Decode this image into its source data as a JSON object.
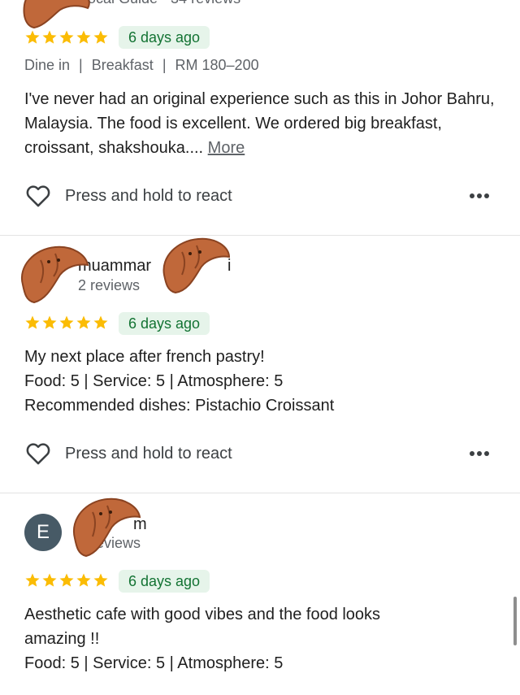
{
  "reviews": [
    {
      "sub_partial": "ocal Guide · 34 reviews",
      "rating": 5,
      "time": "6 days ago",
      "tags": {
        "t1": "Dine in",
        "sep1": "|",
        "t2": "Breakfast",
        "sep2": "|",
        "t3": "RM 180–200"
      },
      "text": "I've never had an original experience such as this in Johor Bahru, Malaysia. The food is excellent. We ordered big breakfast, croissant, shakshouka.... ",
      "more": "More",
      "react": "Press and hold to react"
    },
    {
      "name_left": "muammar",
      "name_right": "i",
      "sub": "2 reviews",
      "rating": 5,
      "time": "6 days ago",
      "line1": "My next place after french pastry!",
      "food_label": "Food:",
      "food_val": " 5 | ",
      "service_label": "Service:",
      "service_val": " 5 | ",
      "atmos_label": "Atmosphere:",
      "atmos_val": " 5",
      "dishes_label": "Recommended dishes:",
      "dishes_val": " Pistachio Croissant",
      "react": "Press and hold to react"
    },
    {
      "avatar_letter": "E",
      "name_right": "m",
      "sub_partial": "eviews",
      "rating": 5,
      "time": "6 days ago",
      "line1": "Aesthetic cafe with good vibes and the food looks amazing !!",
      "food_label": "Food:",
      "food_val": " 5 | ",
      "service_label": "Service:",
      "service_val": " 5 | ",
      "atmos_label": "Atmosphere:",
      "atmos_val": " 5"
    }
  ],
  "colors": {
    "star": "#fbbc04",
    "chip_bg": "#e6f4ea",
    "chip_text": "#137333",
    "avatar": "#475a66",
    "croissant": "#c0683a"
  },
  "icons": {
    "react": "heart-outline-icon",
    "menu": "more-dots-icon",
    "rating": "star-icon",
    "sticker": "croissant-sticker"
  }
}
